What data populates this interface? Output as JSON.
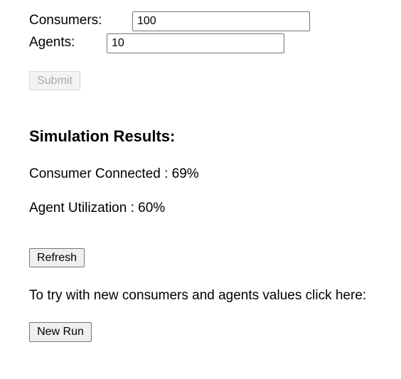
{
  "form": {
    "consumers_label": "Consumers:",
    "consumers_value": "100",
    "agents_label": "Agents:",
    "agents_value": "10",
    "submit_label": "Submit"
  },
  "results": {
    "heading": "Simulation Results:",
    "consumer_connected": "Consumer Connected : 69%",
    "agent_utilization": "Agent Utilization : 60%",
    "refresh_label": "Refresh",
    "new_run_prompt": "To try with new consumers and agents values click here:",
    "new_run_label": "New Run"
  }
}
